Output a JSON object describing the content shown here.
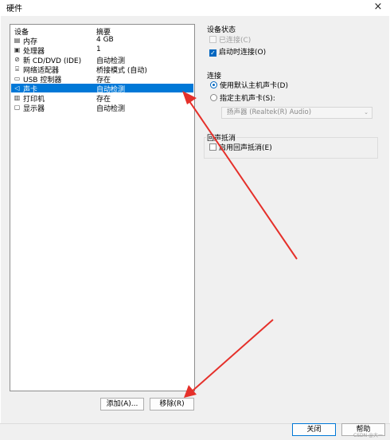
{
  "window": {
    "title": "硬件",
    "close_glyph": "×"
  },
  "device_list": {
    "columns": {
      "device": "设备",
      "summary": "摘要"
    },
    "rows": [
      {
        "icon": "memory-icon",
        "glyph": "▤",
        "name": "内存",
        "summary": "4 GB"
      },
      {
        "icon": "processor-icon",
        "glyph": "▣",
        "name": "处理器",
        "summary": "1"
      },
      {
        "icon": "cd-dvd-icon",
        "glyph": "⊘",
        "name": "新 CD/DVD (IDE)",
        "summary": "自动检测"
      },
      {
        "icon": "network-adapter-icon",
        "glyph": "⌸",
        "name": "网络适配器",
        "summary": "桥接模式 (自动)"
      },
      {
        "icon": "usb-controller-icon",
        "glyph": "▭",
        "name": "USB 控制器",
        "summary": "存在"
      },
      {
        "icon": "sound-card-icon",
        "glyph": "◁",
        "name": "声卡",
        "summary": "自动检测",
        "selected": true
      },
      {
        "icon": "printer-icon",
        "glyph": "▥",
        "name": "打印机",
        "summary": "存在"
      },
      {
        "icon": "display-icon",
        "glyph": "▢",
        "name": "显示器",
        "summary": "自动检测"
      }
    ]
  },
  "buttons": {
    "add": "添加(A)...",
    "remove": "移除(R)",
    "close": "关闭",
    "help": "帮助"
  },
  "device_status": {
    "title": "设备状态",
    "connected": {
      "label": "已连接(C)",
      "checked": false,
      "disabled": true
    },
    "connect_at_power_on": {
      "label": "启动时连接(O)",
      "checked": true,
      "check_glyph": "✓"
    }
  },
  "connection": {
    "title": "连接",
    "use_default": {
      "label": "使用默认主机声卡(D)",
      "selected": true
    },
    "specify": {
      "label": "指定主机声卡(S):",
      "selected": false
    },
    "device_select": {
      "value": "扬声器 (Realtek(R) Audio)",
      "chevron": "⌄"
    }
  },
  "echo_cancellation": {
    "title": "回声抵消",
    "enable": {
      "label": "启用回声抵消(E)",
      "checked": false
    }
  },
  "colors": {
    "accent": "#0078d7",
    "arrow": "#e5302a"
  },
  "watermark": "CSDN @大一"
}
